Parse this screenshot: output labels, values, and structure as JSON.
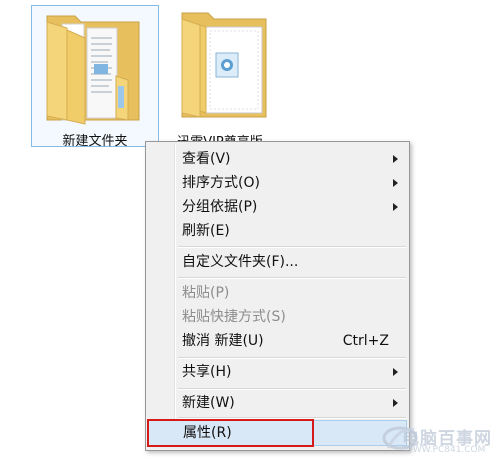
{
  "desktop": {
    "items": [
      {
        "label": "新建文件夹",
        "icon": "folder-with-files-icon",
        "selected": true
      },
      {
        "label": "迅雷VIP尊享版",
        "icon": "folder-with-document-icon",
        "selected": false
      }
    ]
  },
  "context_menu": {
    "items": [
      {
        "label": "查看(V)",
        "submenu": true
      },
      {
        "label": "排序方式(O)",
        "submenu": true
      },
      {
        "label": "分组依据(P)",
        "submenu": true
      },
      {
        "label": "刷新(E)"
      },
      {
        "label": "自定义文件夹(F)..."
      },
      {
        "label": "粘贴(P)",
        "disabled": true
      },
      {
        "label": "粘贴快捷方式(S)",
        "disabled": true
      },
      {
        "label": "撤消 新建(U)",
        "shortcut": "Ctrl+Z"
      },
      {
        "label": "共享(H)",
        "submenu": true
      },
      {
        "label": "新建(W)",
        "submenu": true
      },
      {
        "label": "属性(R)",
        "highlighted": true
      }
    ]
  },
  "annotation": {
    "color": "#d51a1a",
    "target": "属性(R)"
  },
  "watermark": {
    "text": "电脑百事网",
    "sub": "WWW.PC841.COM"
  },
  "colors": {
    "menu_bg": "#f0f0f0",
    "selection": "#d9e8f7",
    "folder": "#f5d57a"
  }
}
